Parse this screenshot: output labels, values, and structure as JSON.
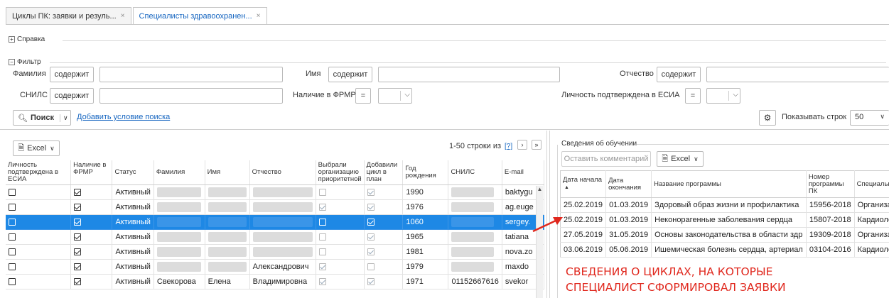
{
  "tabs": [
    {
      "label": "Циклы ПК: заявки и резуль...",
      "close": "×"
    },
    {
      "label": "Специалисты здравоохранен...",
      "close": "×"
    }
  ],
  "help_legend": "Справка",
  "filter": {
    "legend": "Фильтр",
    "surname_label": "Фамилия",
    "name_label": "Имя",
    "patronymic_label": "Отчество",
    "snils_label": "СНИЛС",
    "frmr_label": "Наличие в ФРМР",
    "esia_label": "Личность подтверждена в ЕСИА",
    "contains": "содержит",
    "equals": "=",
    "search_button": "Поиск",
    "add_condition": "Добавить условие поиска",
    "rows_label": "Показывать строк",
    "rows_value": "50"
  },
  "left_grid": {
    "excel_label": "Excel",
    "pager": "1-50 строки из",
    "pager_total": "[?]",
    "columns": [
      "Личность подтверждена в ЕСИА",
      "Наличие в ФРМР",
      "Статус",
      "Фамилия",
      "Имя",
      "Отчество",
      "Выбрали организацию приоритетной",
      "Добавили цикл в план",
      "Год рождения",
      "СНИЛС",
      "E-mail"
    ],
    "rows": [
      {
        "status": "Активный",
        "surname": "",
        "name": "",
        "patronymic": "",
        "year": "1990",
        "snils": "",
        "email": "baktygu"
      },
      {
        "status": "Активный",
        "surname": "",
        "name": "",
        "patronymic": "",
        "year": "1976",
        "snils": "",
        "email": "ag.euge"
      },
      {
        "status": "Активный",
        "surname": "",
        "name": "",
        "patronymic": "",
        "year": "1060",
        "snils": "",
        "email": "sergey."
      },
      {
        "status": "Активный",
        "surname": "",
        "name": "",
        "patronymic": "",
        "year": "1965",
        "snils": "",
        "email": "tatiana"
      },
      {
        "status": "Активный",
        "surname": "",
        "name": "",
        "patronymic": "",
        "year": "1981",
        "snils": "",
        "email": "nova.zo"
      },
      {
        "status": "Активный",
        "surname": "",
        "name": "",
        "patronymic": "Александрович",
        "year": "1979",
        "snils": "",
        "email": "maxdo"
      },
      {
        "status": "Активный",
        "surname": "Свекорова",
        "name": "Елена",
        "patronymic": "Владимировна",
        "year": "1971",
        "snils": "01152667616",
        "email": "svekor"
      }
    ]
  },
  "right_panel": {
    "legend": "Сведения об обучении",
    "comment_button": "Оставить комментарий",
    "excel_label": "Excel",
    "columns": [
      "Дата начала",
      "Дата окончания",
      "Название программы",
      "Номер программы ПК",
      "Специальнос"
    ],
    "rows": [
      {
        "start": "25.02.2019",
        "end": "01.03.2019",
        "program": "Здоровый образ жизни и профилактика",
        "number": "15956-2018",
        "spec": "Организац"
      },
      {
        "start": "25.02.2019",
        "end": "01.03.2019",
        "program": "Неконорагенные заболевания сердца",
        "number": "15807-2018",
        "spec": "Кардиологи"
      },
      {
        "start": "27.05.2019",
        "end": "31.05.2019",
        "program": "Основы законодательства в области здр",
        "number": "19309-2018",
        "spec": "Организац"
      },
      {
        "start": "03.06.2019",
        "end": "05.06.2019",
        "program": "Ишемическая болезнь сердца, артериал",
        "number": "03104-2016",
        "spec": "Кардиологи"
      }
    ]
  },
  "annotation": {
    "line1": "СВЕДЕНИЯ О ЦИКЛАХ, НА КОТОРЫЕ",
    "line2": "СПЕЦИАЛИСТ СФОРМИРОВАЛ ЗАЯВКИ"
  },
  "colors": {
    "accent": "#1565c0",
    "selection": "#1e88e5",
    "annotation": "#e0281e"
  }
}
